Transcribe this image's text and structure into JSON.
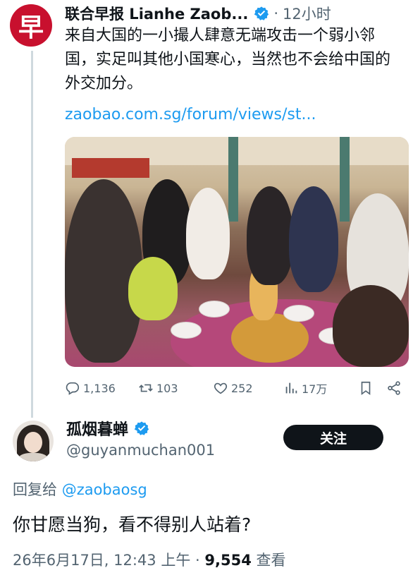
{
  "original_tweet": {
    "avatar_glyph": "早",
    "author_name": "联合早报 Lianhe Zaob...",
    "dot": "·",
    "time": "12小时",
    "text": "来自大国的一小撮人肆意无端攻击一个弱小邻国，实足叫其他小国寒心，当然也不会给中国的外交加分。",
    "link": "zaobao.com.sg/forum/views/st...",
    "stats": {
      "replies": "1,136",
      "retweets": "103",
      "likes": "252",
      "views": "17万"
    }
  },
  "reply_tweet": {
    "author_name": "孤烟暮蝉",
    "handle": "@guyanmuchan001",
    "follow_label": "关注",
    "reply_to_prefix": "回复给 ",
    "reply_to_mention": "@zaobaosg",
    "text": "你甘愿当狗，看不得别人站着?",
    "timestamp": "26年6月17日, 12:43 上午",
    "meta_dot": " · ",
    "views_count": "9,554",
    "views_label": " 查看"
  },
  "colors": {
    "accent": "#1d9bf0",
    "verified": "#1d9bf0",
    "muted": "#536471",
    "brand_red": "#c8102e"
  },
  "icons": [
    "reply-icon",
    "retweet-icon",
    "like-icon",
    "views-icon",
    "bookmark-icon",
    "share-icon",
    "verified-badge-icon"
  ]
}
